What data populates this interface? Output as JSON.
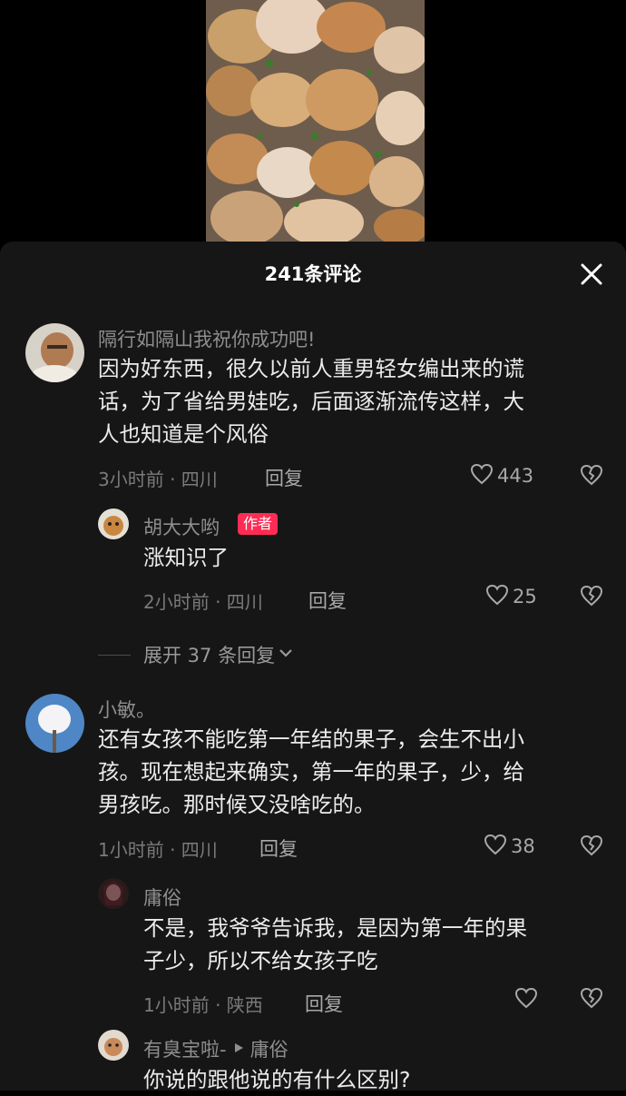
{
  "header": {
    "title": "241条评论"
  },
  "comments": [
    {
      "username": "隔行如隔山我祝你成功吧!",
      "content_lines": [
        "因为好东西，很久以前人重男轻女编出来的谎",
        "话，为了省给男娃吃，后面逐渐流传这样，大",
        "人也知道是个风俗"
      ],
      "meta": "3小时前 · 四川",
      "reply_label": "回复",
      "likes": "443"
    },
    {
      "username": "小敏。",
      "content_lines": [
        "还有女孩不能吃第一年结的果子，会生不出小",
        "孩。现在想起来确实，第一年的果子，少，给",
        "男孩吃。那时候又没啥吃的。"
      ],
      "meta": "1小时前 · 四川",
      "reply_label": "回复",
      "likes": "38"
    }
  ],
  "replies": [
    {
      "username": "胡大大哟",
      "badge": "作者",
      "content_lines": [
        "涨知识了"
      ],
      "meta": "2小时前 · 四川",
      "reply_label": "回复",
      "likes": "25"
    },
    {
      "username": "庸俗",
      "content_lines": [
        "不是，我爷爷告诉我，是因为第一年的果",
        "子少，所以不给女孩子吃"
      ],
      "meta": "1小时前 · 陕西",
      "reply_label": "回复",
      "likes": ""
    },
    {
      "username": "有臭宝啦-",
      "reply_to": "庸俗",
      "content_lines": [
        "你说的跟他说的有什么区别?"
      ]
    }
  ],
  "expand": {
    "label": "展开 37 条回复"
  },
  "colors": {
    "sheet_bg": "#161616",
    "author_badge": "#fe2c55",
    "text_primary": "#ececec",
    "text_secondary": "#8e8e8e"
  }
}
